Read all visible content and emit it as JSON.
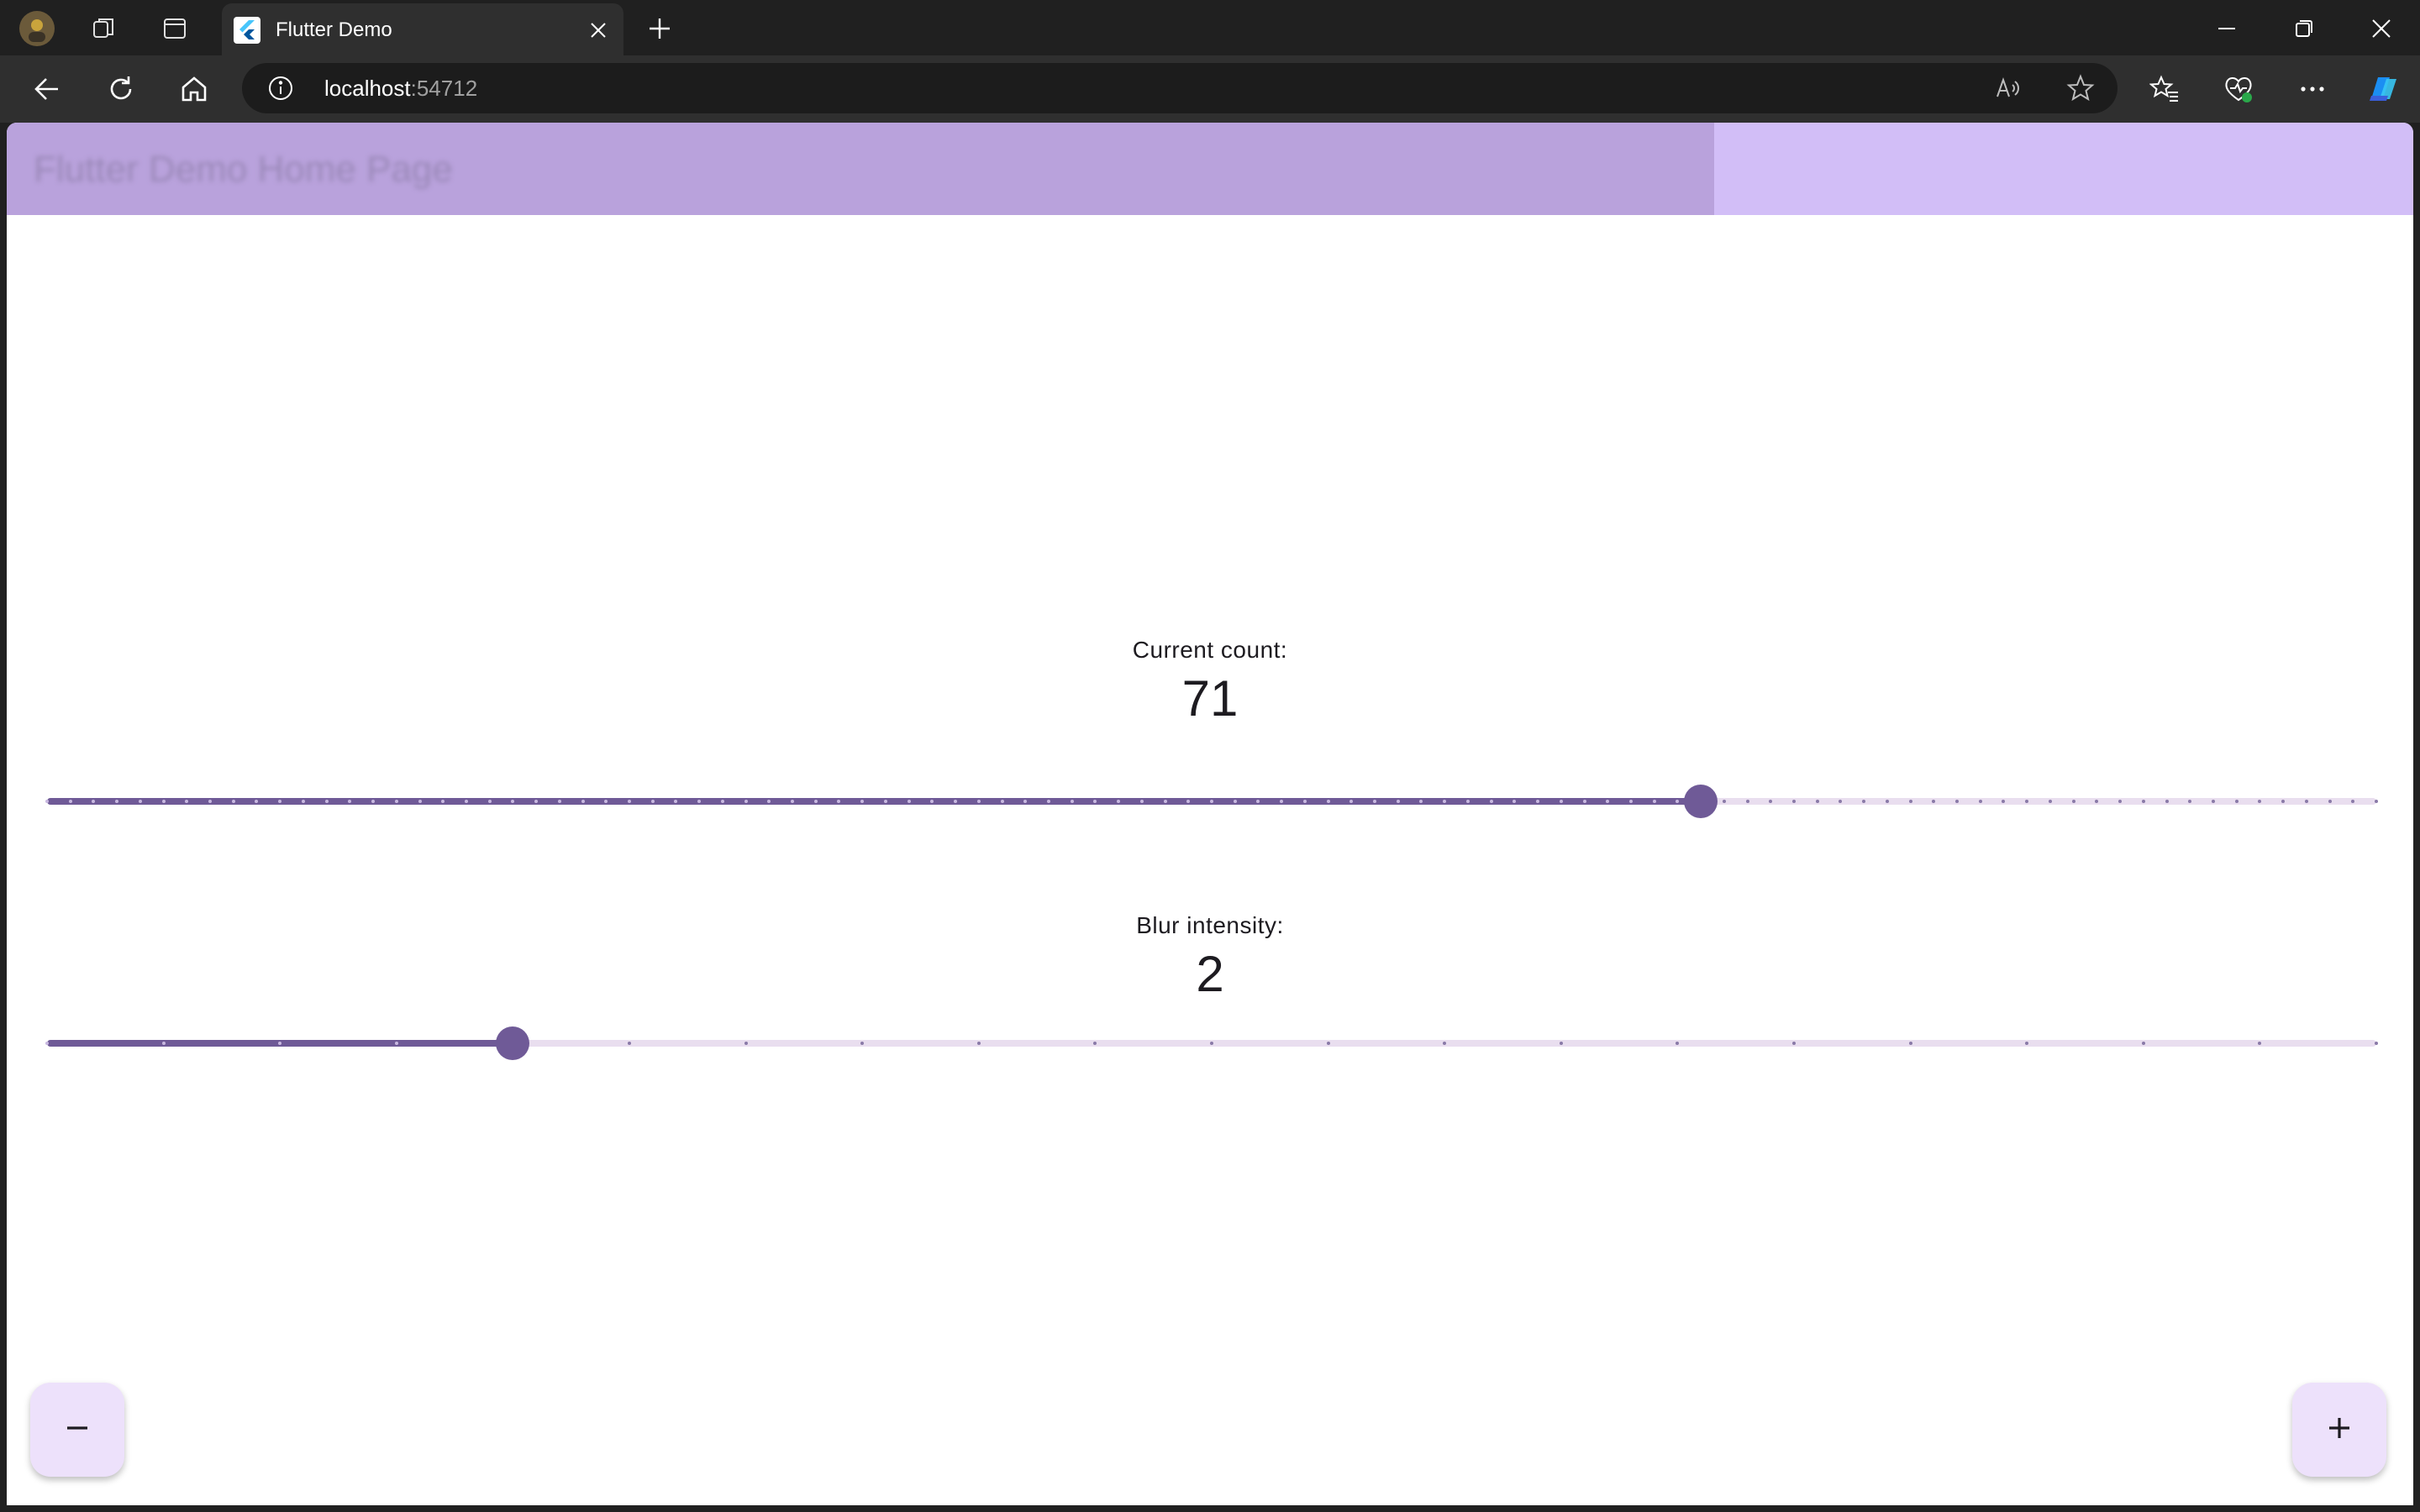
{
  "browser": {
    "tab_title": "Flutter Demo",
    "address_host": "localhost",
    "address_port": ":54712",
    "icons": [
      "profile-avatar",
      "workspaces-icon",
      "tab-actions-icon",
      "flutter-favicon",
      "close-icon",
      "new-tab-icon",
      "minimize-icon",
      "restore-icon",
      "window-close-icon",
      "back-icon",
      "refresh-icon",
      "home-icon",
      "site-info-icon",
      "read-aloud-icon",
      "add-favorite-icon",
      "favorites-icon",
      "browser-essentials-icon",
      "more-icon",
      "copilot-icon"
    ]
  },
  "colors": {
    "primary": "#6f5a97",
    "track_inactive": "#e9deef",
    "appbar": "#d2bef7",
    "fab": "#ede1fb"
  },
  "app": {
    "title": "Flutter Demo Home Page"
  },
  "counter": {
    "label": "Current count:",
    "value": "71",
    "slider": {
      "min": 0,
      "max": 100,
      "divisions": 100,
      "value": 71
    }
  },
  "blur": {
    "label": "Blur intensity:",
    "value": "2",
    "slider": {
      "min": 0,
      "max": 20,
      "divisions": 20,
      "value": 4
    }
  },
  "fab": {
    "decrement_icon": "remove-icon",
    "increment_icon": "add-icon"
  }
}
